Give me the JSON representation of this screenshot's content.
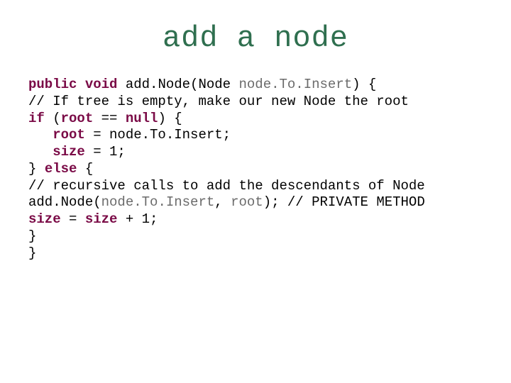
{
  "slide": {
    "title": "add a node",
    "code": {
      "l1": {
        "kw_public": "public",
        "kw_void": "void",
        "fn": "add.Node(Node ",
        "param": "node.To.Insert",
        "tail": ") {"
      },
      "l2": "// If tree is empty, make our new Node the root",
      "l3": {
        "kw_if": "if",
        "open": " (",
        "root": "root",
        "eqeq": " == ",
        "null": "null",
        "close": ") {"
      },
      "l4": {
        "root": "root",
        "rest": " = node.To.Insert;"
      },
      "l5": {
        "size": "size",
        "rest": " = 1;"
      },
      "l6": {
        "brace": "} ",
        "kw_else": "else",
        "rest": " {"
      },
      "l7": "// recursive calls to add the descendants of Node",
      "l8": {
        "fn": "add.Node(",
        "arg1": "node.To.Insert",
        "sep": ", ",
        "arg2": "root",
        "tail": "); // PRIVATE METHOD"
      },
      "l9": {
        "size1": "size",
        "mid": " = ",
        "size2": "size",
        "tail": " + 1;"
      },
      "l10": "}",
      "l11": "}"
    }
  }
}
